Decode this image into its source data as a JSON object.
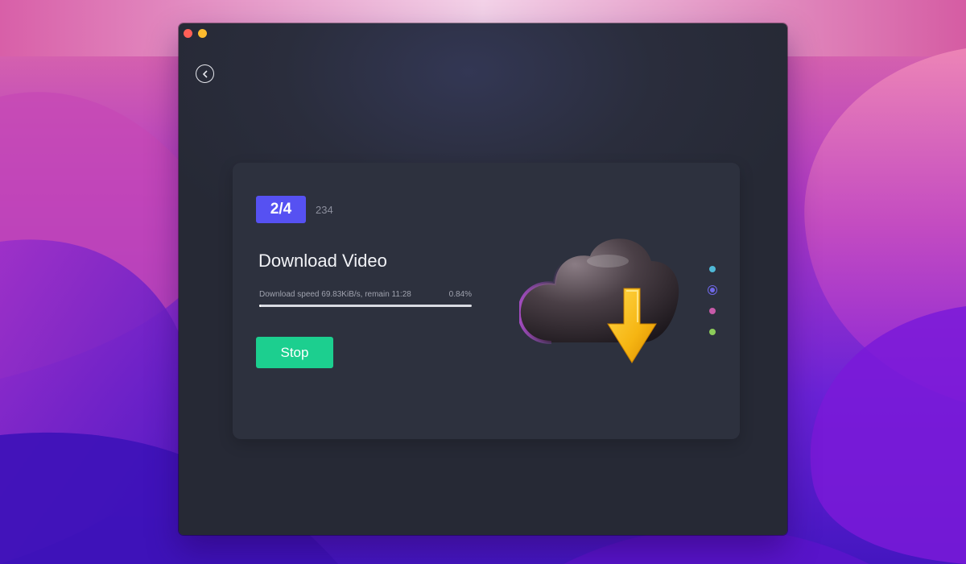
{
  "window": {
    "traffic_lights": [
      "close",
      "minimize"
    ]
  },
  "navigation": {
    "back_icon": "chevron-left-icon"
  },
  "card": {
    "step_badge": "2/4",
    "step_number": "234",
    "title": "Download Video",
    "progress": {
      "status_text": "Download speed 69.83KiB/s, remain 11:28",
      "percent_text": "0.84%",
      "fraction": 0.0084
    },
    "stop_label": "Stop",
    "illustration_icon": "cloud-download-icon",
    "carousel": {
      "count": 4,
      "active_index": 1,
      "dot_colors": [
        "#4fb8d6",
        "#6f68e8",
        "#c75aa8",
        "#8ccc5a"
      ]
    }
  },
  "colors": {
    "accent": "#5651f2",
    "stop_button": "#1ccf8f",
    "window_bg": "#2a2d3c",
    "card_bg": "#2d313e"
  }
}
